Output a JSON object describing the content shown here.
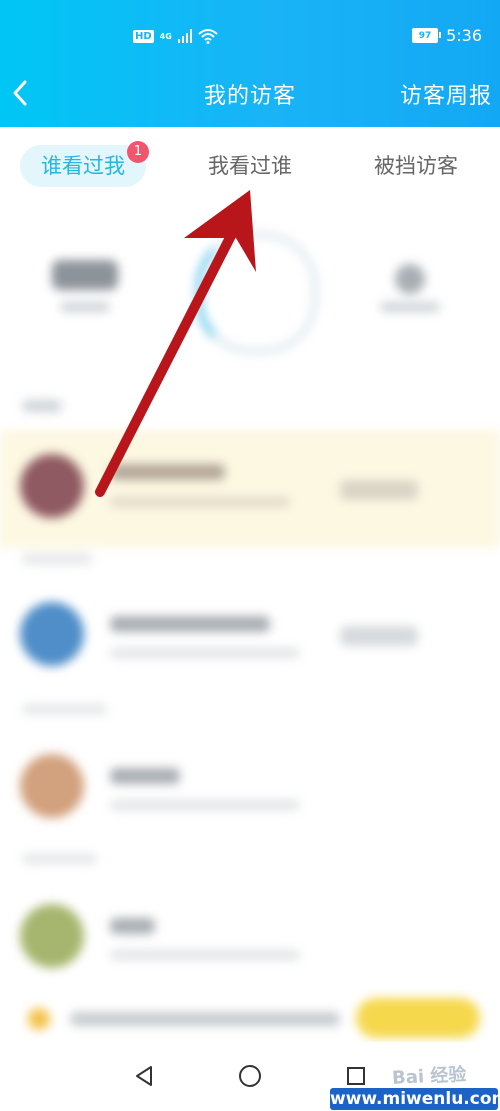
{
  "status_bar": {
    "hd": "HD",
    "network": "4G",
    "battery_level": "97",
    "time": "5:36"
  },
  "nav": {
    "title": "我的访客",
    "right_action": "访客周报"
  },
  "tabs": [
    {
      "label": "谁看过我",
      "badge": "1",
      "active": true
    },
    {
      "label": "我看过谁",
      "active": false
    },
    {
      "label": "被挡访客",
      "active": false
    }
  ],
  "colors": {
    "header_start": "#00c6f5",
    "header_end": "#13a8f4",
    "active_tab_text": "#26b7df",
    "badge": "#f2566e",
    "arrow": "#b8161a"
  },
  "icons": {
    "back": "chevron-left-icon",
    "nav_back": "triangle-back-icon",
    "nav_home": "circle-home-icon",
    "nav_recent": "square-recent-icon"
  },
  "watermark": {
    "brand": "Bai 经验",
    "site": "www.miwenlu.com"
  }
}
